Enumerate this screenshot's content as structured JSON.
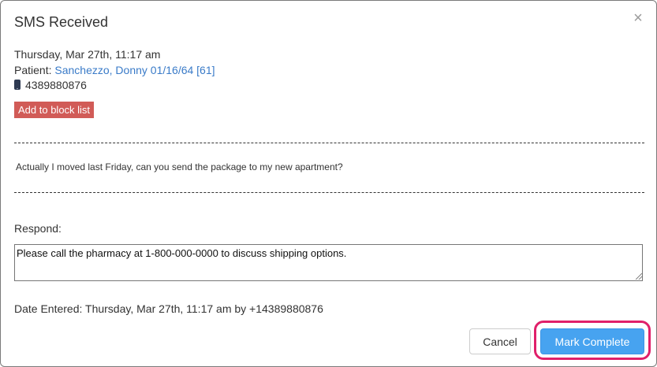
{
  "modal": {
    "title": "SMS Received",
    "close_symbol": "×"
  },
  "sms": {
    "received_at": "Thursday, Mar 27th, 11:17 am",
    "patient_label": "Patient: ",
    "patient_link": "Sanchezzo, Donny 01/16/64 [61]",
    "phone_icon": "mobile-phone-icon",
    "phone_number": "4389880876",
    "block_button_label": "Add to block list",
    "message_text": "Actually I moved last Friday, can you send the package to my new apartment?"
  },
  "respond": {
    "label": "Respond:",
    "value": "Please call the pharmacy at 1-800-000-0000 to discuss shipping options."
  },
  "date_entered": "Date Entered: Thursday, Mar 27th, 11:17 am by +14389880876",
  "footer": {
    "cancel_label": "Cancel",
    "complete_label": "Mark Complete"
  },
  "colors": {
    "link": "#3a7bc8",
    "block_button": "#d15b57",
    "primary_button": "#47a3f0",
    "highlight": "#e0206a"
  }
}
